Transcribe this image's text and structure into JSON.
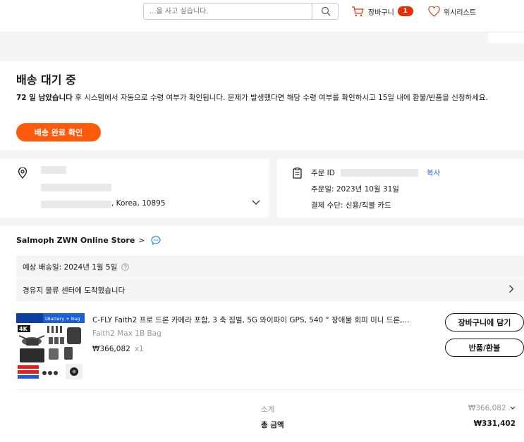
{
  "header": {
    "search_placeholder": "...을 사고 싶습니다.",
    "cart_label": "장바구니",
    "cart_count": "1",
    "wishlist_label": "위시리스트"
  },
  "status": {
    "title": "배송 대기 중",
    "days_highlight": "72 일 남았습니다",
    "description": " 후 시스템에서 자동으로 수령 여부가 확인됩니다. 문제가 발생했다면 해당 수령 여부를 확인하시고 15일 내에 환불/반품을 신청하세요.",
    "confirm_button": "배송 완료 확인"
  },
  "address": {
    "line3_suffix": ", Korea, 10895"
  },
  "order": {
    "id_label": "주문 ID",
    "copy_label": "복사",
    "date": "주문일: 2023년 10월 31일",
    "payment": "결제 수단: 신용/직불 카드"
  },
  "store": {
    "name": "Salmoph ZWN Online Store",
    "arrow": ">",
    "estimated_delivery": "예상 배송일: 2024년 1월 5일",
    "logistics_status": "경유지 물류 센터에 도착했습니다"
  },
  "product": {
    "title": "C-FLY Faith2 프로 드론 카메라 포함, 3 축 짐벌, 5G 와이파이 GPS, 540 ° 장애물 회피 미니 드론,...",
    "variant": "Faith2 Max 1B Bag",
    "price": "₩366,082",
    "quantity": "x1",
    "add_to_cart_button": "장바구니에 담기",
    "refund_button": "반품/환불",
    "thumb_text_1": "1Battery + Bag",
    "thumb_text_2": "4K"
  },
  "summary": {
    "subtotal_label": "소계",
    "subtotal_value": "₩366,082",
    "total_label": "총 금액",
    "total_value": "₩331,402"
  },
  "colors": {
    "accent": "#fd5a0b",
    "badge": "#e62e04",
    "link": "#2e6bd6"
  }
}
